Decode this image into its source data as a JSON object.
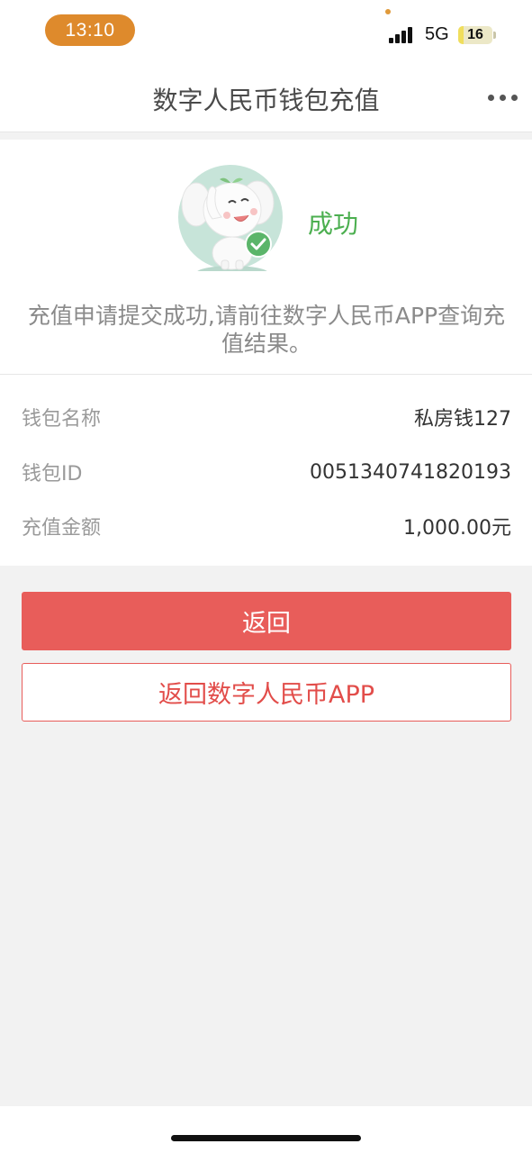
{
  "status_bar": {
    "time": "13:10",
    "network": "5G",
    "battery_level": "16",
    "battery_fraction": 0.16
  },
  "header": {
    "title": "数字人民币钱包充值",
    "more_icon": "more-dots-icon"
  },
  "result": {
    "icon": "elephant-mascot-success-icon",
    "status": "成功",
    "message": "充值申请提交成功,请前往数字人民币APP查询充值结果。",
    "accent_color": "#4caf50"
  },
  "details": [
    {
      "label": "钱包名称",
      "value": "私房钱127"
    },
    {
      "label": "钱包ID",
      "value": "0051340741820193"
    },
    {
      "label": "充值金额",
      "value": "1,000.00元"
    }
  ],
  "actions": {
    "back_label": "返回",
    "back_to_app_label": "返回数字人民币APP",
    "primary_color": "#e85d5a"
  }
}
